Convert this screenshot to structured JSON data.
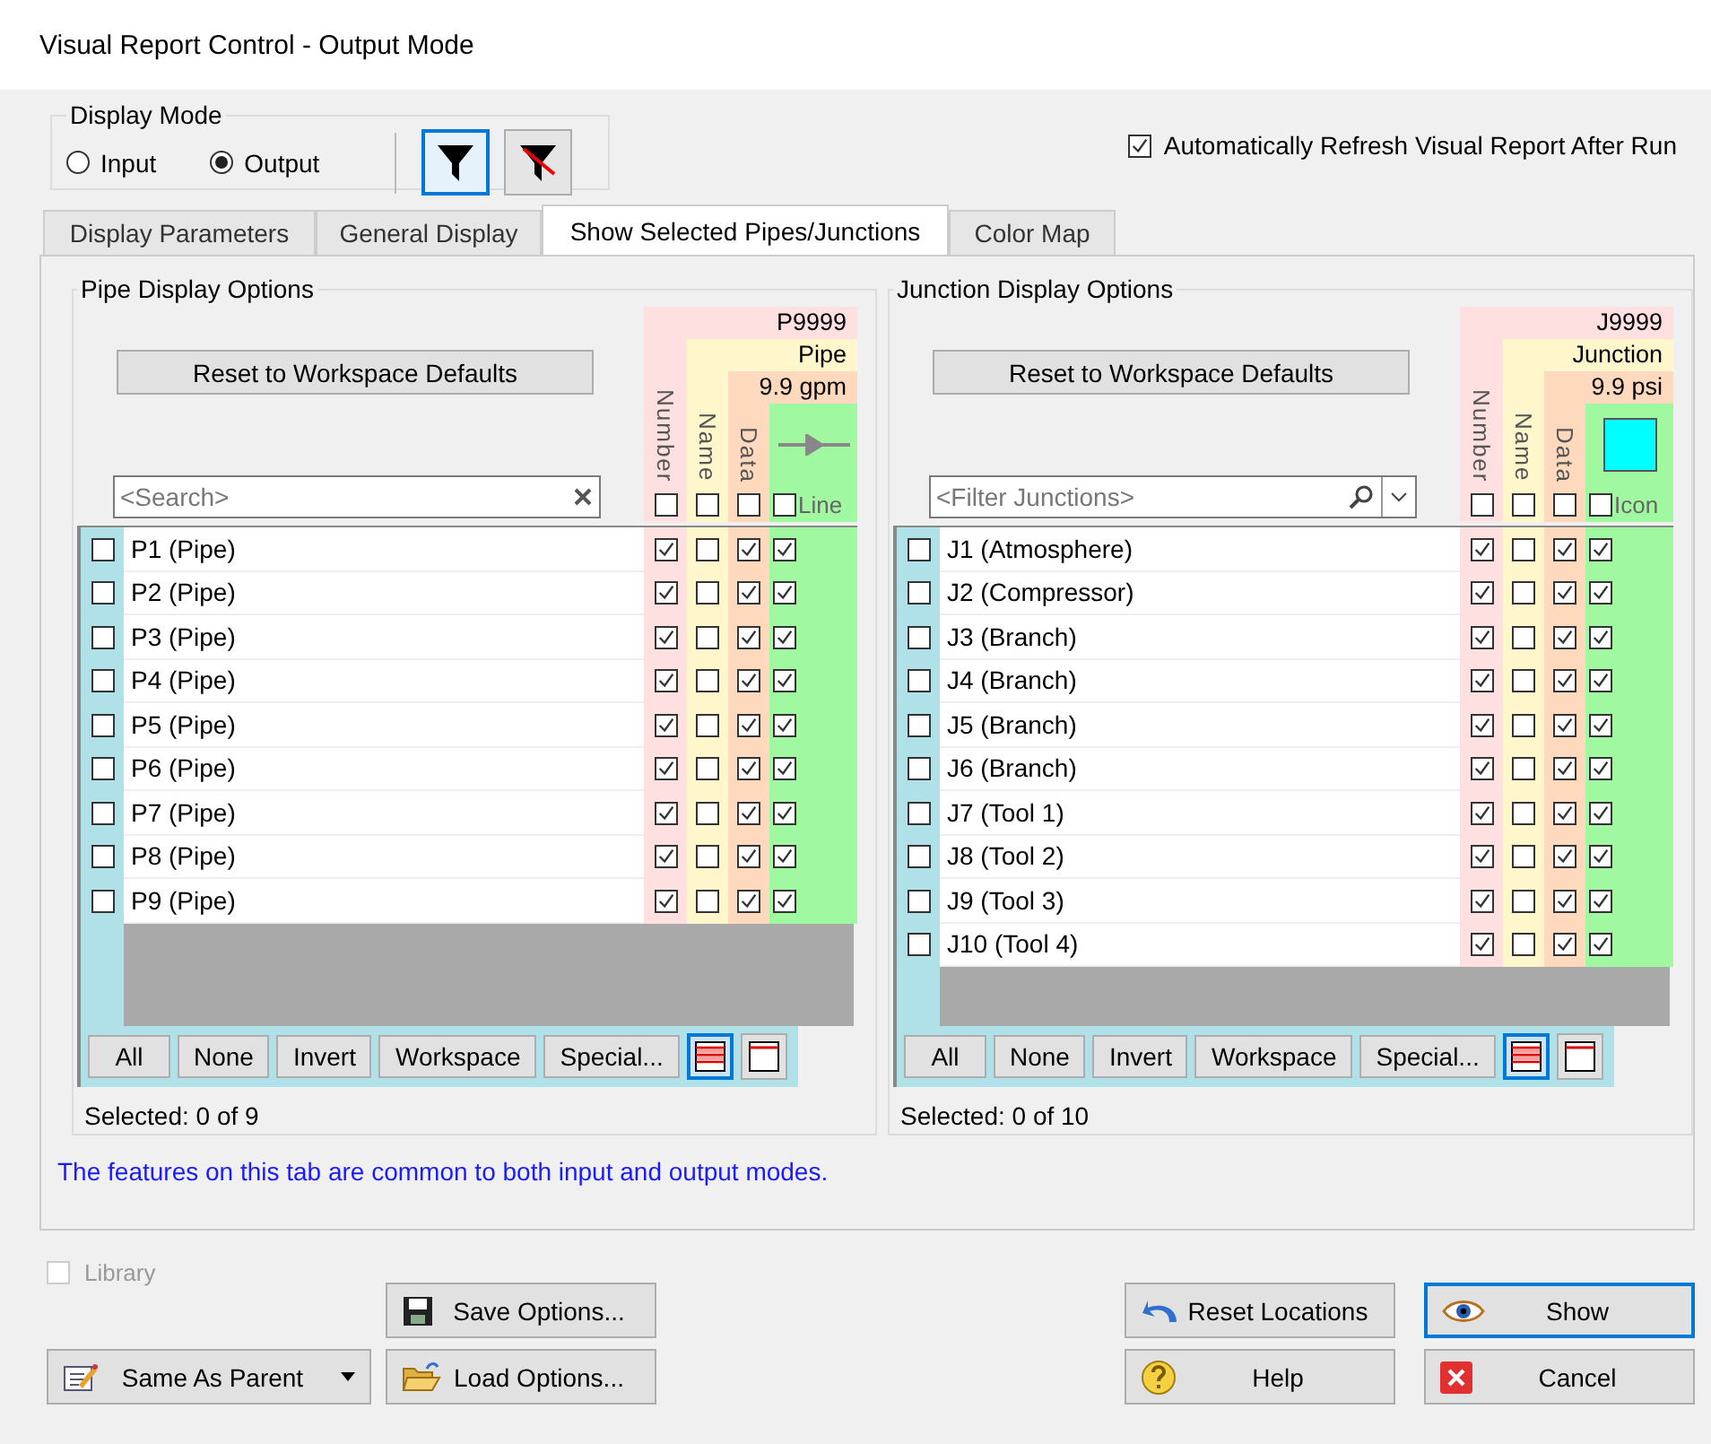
{
  "window": {
    "title": "Visual Report Control - Output Mode"
  },
  "display_mode": {
    "label": "Display Mode",
    "options": [
      {
        "label": "Input",
        "selected": false
      },
      {
        "label": "Output",
        "selected": true
      }
    ],
    "filter_buttons": [
      {
        "kind": "filter",
        "selected": true
      },
      {
        "kind": "filter-off",
        "selected": false
      }
    ]
  },
  "auto_refresh": {
    "label": "Automatically Refresh Visual Report After Run",
    "checked": true
  },
  "tabs": [
    {
      "label": "Display Parameters",
      "selected": false
    },
    {
      "label": "General Display",
      "selected": false
    },
    {
      "label": "Show Selected Pipes/Junctions",
      "selected": true
    },
    {
      "label": "Color Map",
      "selected": false
    }
  ],
  "panels": [
    {
      "title": "Pipe Display Options",
      "reset_label": "Reset to Workspace Defaults",
      "search": {
        "placeholder": "<Search>",
        "kind": "clear"
      },
      "header": {
        "number_label": "Number",
        "name_label": "Name",
        "data_label": "Data",
        "sample_number": "P9999",
        "sample_name": "Pipe",
        "sample_data": "9.9 gpm",
        "symbol": {
          "kind": "line",
          "label": "Line"
        }
      },
      "header_checks": [
        {
          "checked": false
        },
        {
          "checked": false
        },
        {
          "checked": false
        },
        {
          "checked": false
        }
      ],
      "rows": [
        {
          "label": "P1 (Pipe)",
          "checked": false,
          "number": true,
          "name": false,
          "data": true,
          "symbol": true
        },
        {
          "label": "P2 (Pipe)",
          "checked": false,
          "number": true,
          "name": false,
          "data": true,
          "symbol": true
        },
        {
          "label": "P3 (Pipe)",
          "checked": false,
          "number": true,
          "name": false,
          "data": true,
          "symbol": true
        },
        {
          "label": "P4 (Pipe)",
          "checked": false,
          "number": true,
          "name": false,
          "data": true,
          "symbol": true
        },
        {
          "label": "P5 (Pipe)",
          "checked": false,
          "number": true,
          "name": false,
          "data": true,
          "symbol": true
        },
        {
          "label": "P6 (Pipe)",
          "checked": false,
          "number": true,
          "name": false,
          "data": true,
          "symbol": true
        },
        {
          "label": "P7 (Pipe)",
          "checked": false,
          "number": true,
          "name": false,
          "data": true,
          "symbol": true
        },
        {
          "label": "P8 (Pipe)",
          "checked": false,
          "number": true,
          "name": false,
          "data": true,
          "symbol": true
        },
        {
          "label": "P9 (Pipe)",
          "checked": false,
          "number": true,
          "name": false,
          "data": true,
          "symbol": true
        }
      ],
      "buttons": [
        "All",
        "None",
        "Invert",
        "Workspace",
        "Special..."
      ],
      "view_buttons": [
        {
          "kind": "all-rows",
          "selected": true
        },
        {
          "kind": "header-row",
          "selected": false
        }
      ],
      "status": "Selected: 0 of 9"
    },
    {
      "title": "Junction Display Options",
      "reset_label": "Reset to Workspace Defaults",
      "search": {
        "placeholder": "<Filter Junctions>",
        "kind": "dropdown"
      },
      "header": {
        "number_label": "Number",
        "name_label": "Name",
        "data_label": "Data",
        "sample_number": "J9999",
        "sample_name": "Junction",
        "sample_data": "9.9 psi",
        "symbol": {
          "kind": "icon",
          "label": "Icon"
        }
      },
      "header_checks": [
        {
          "checked": false
        },
        {
          "checked": false
        },
        {
          "checked": false
        },
        {
          "checked": false
        }
      ],
      "rows": [
        {
          "label": "J1 (Atmosphere)",
          "checked": false,
          "number": true,
          "name": false,
          "data": true,
          "symbol": true
        },
        {
          "label": "J2 (Compressor)",
          "checked": false,
          "number": true,
          "name": false,
          "data": true,
          "symbol": true
        },
        {
          "label": "J3 (Branch)",
          "checked": false,
          "number": true,
          "name": false,
          "data": true,
          "symbol": true
        },
        {
          "label": "J4 (Branch)",
          "checked": false,
          "number": true,
          "name": false,
          "data": true,
          "symbol": true
        },
        {
          "label": "J5 (Branch)",
          "checked": false,
          "number": true,
          "name": false,
          "data": true,
          "symbol": true
        },
        {
          "label": "J6 (Branch)",
          "checked": false,
          "number": true,
          "name": false,
          "data": true,
          "symbol": true
        },
        {
          "label": "J7 (Tool 1)",
          "checked": false,
          "number": true,
          "name": false,
          "data": true,
          "symbol": true
        },
        {
          "label": "J8 (Tool 2)",
          "checked": false,
          "number": true,
          "name": false,
          "data": true,
          "symbol": true
        },
        {
          "label": "J9 (Tool 3)",
          "checked": false,
          "number": true,
          "name": false,
          "data": true,
          "symbol": true
        },
        {
          "label": "J10 (Tool 4)",
          "checked": false,
          "number": true,
          "name": false,
          "data": true,
          "symbol": true
        }
      ],
      "buttons": [
        "All",
        "None",
        "Invert",
        "Workspace",
        "Special..."
      ],
      "view_buttons": [
        {
          "kind": "all-rows",
          "selected": true
        },
        {
          "kind": "header-row",
          "selected": false
        }
      ],
      "status": "Selected: 0 of 10"
    }
  ],
  "note": "The features on this tab are common to both input and output modes.",
  "library": {
    "label": "Library",
    "checked": false,
    "disabled": true
  },
  "parent_button": {
    "label": "Same As Parent"
  },
  "footer_buttons": [
    {
      "label": "Save Options...",
      "kind": "save",
      "default": false
    },
    {
      "label": "Load Options...",
      "kind": "load",
      "default": false
    },
    {
      "label": "Reset Locations",
      "kind": "reset",
      "default": false
    },
    {
      "label": "Help",
      "kind": "help",
      "default": false
    },
    {
      "label": "Show",
      "kind": "show",
      "default": true
    },
    {
      "label": "Cancel",
      "kind": "cancel",
      "default": false
    }
  ]
}
